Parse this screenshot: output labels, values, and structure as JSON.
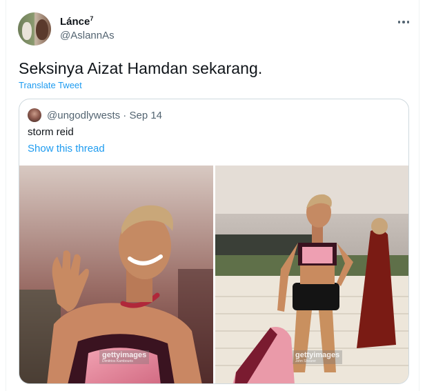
{
  "tweet": {
    "display_name": "Lánce",
    "display_name_sup": "7",
    "handle": "@AslannAs",
    "text": "Seksinya Aizat Hamdan sekarang.",
    "translate_label": "Translate Tweet",
    "more_icon": "more-horizontal-icon"
  },
  "quote": {
    "handle": "@ungodlywests",
    "separator": "·",
    "date": "Sep 14",
    "text": "storm reid",
    "show_thread_label": "Show this thread",
    "images": [
      {
        "watermark": "gettyimages",
        "credit": "Dimitrios Kambouris"
      },
      {
        "watermark": "gettyimages",
        "credit": "John Shearer"
      }
    ]
  },
  "colors": {
    "accent": "#1d9bf0",
    "text": "#0f1419",
    "secondary": "#536471",
    "border": "#cfd9de"
  }
}
